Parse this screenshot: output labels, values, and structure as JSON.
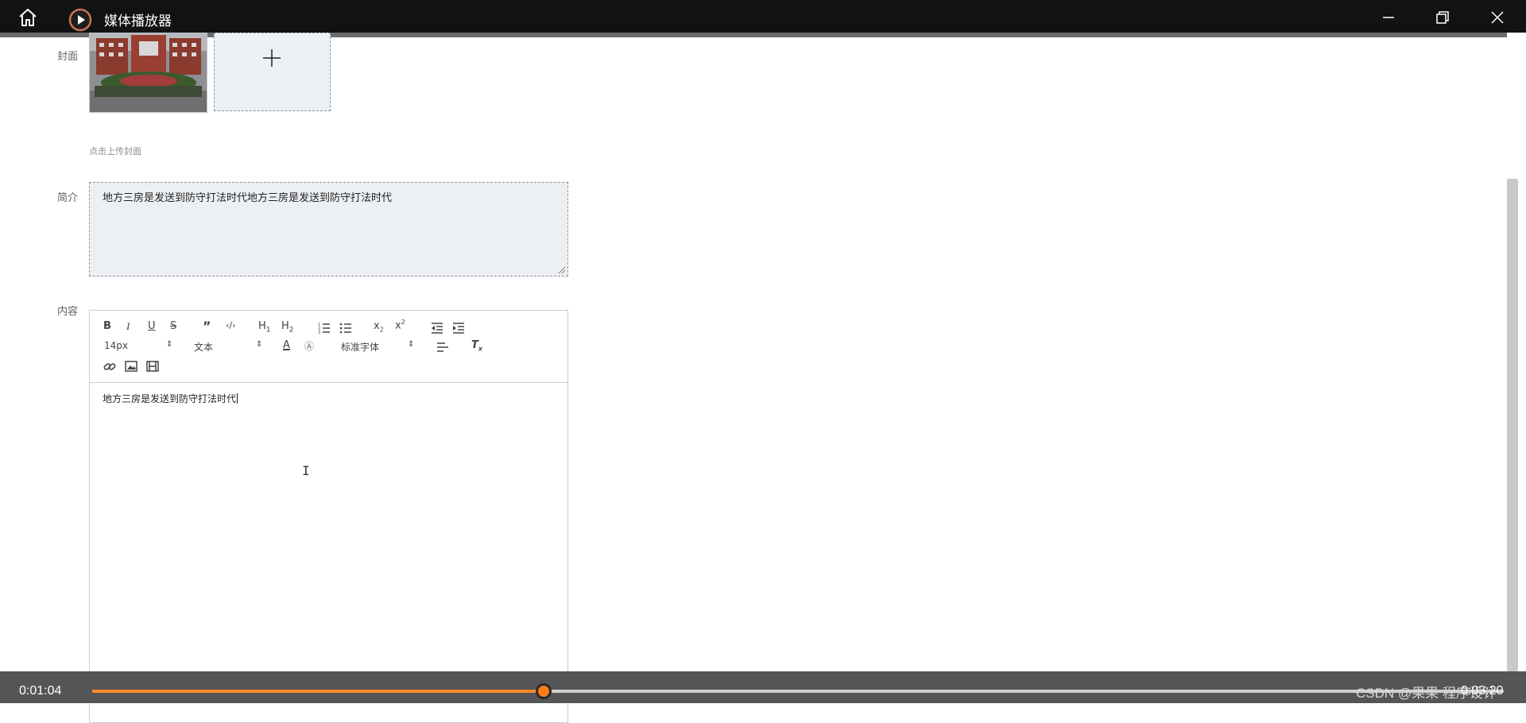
{
  "window": {
    "title": "媒体播放器",
    "controls": {
      "minimize": "minimize-icon",
      "maximize": "restore-icon",
      "close": "close-icon"
    }
  },
  "form": {
    "cover": {
      "label": "封面",
      "hint": "点击上传封面",
      "add_icon": "plus-icon"
    },
    "intro": {
      "label": "简介",
      "value": "地方三房是发送到防守打法时代地方三房是发送到防守打法时代"
    },
    "content": {
      "label": "内容",
      "value": "地方三房是发送到防守打法时代"
    }
  },
  "editor_toolbar": {
    "font_size": "14px",
    "header": "文本",
    "font_family": "标准字体",
    "buttons": [
      "bold-icon",
      "italic-icon",
      "underline-icon",
      "strike-icon",
      "blockquote-icon",
      "code-icon",
      "h1-icon",
      "h2-icon",
      "ordered-list-icon",
      "bullet-list-icon",
      "subscript-icon",
      "superscript-icon",
      "outdent-icon",
      "indent-icon",
      "font-color-icon",
      "background-color-icon",
      "align-icon",
      "clear-format-icon",
      "link-icon",
      "image-icon",
      "video-icon"
    ]
  },
  "player": {
    "current_time": "0:01:04",
    "total_time": "0:03:20",
    "progress": 0.32,
    "watermark": "CSDN @果果 程序设计",
    "accent_color": "#ff7a1a"
  }
}
